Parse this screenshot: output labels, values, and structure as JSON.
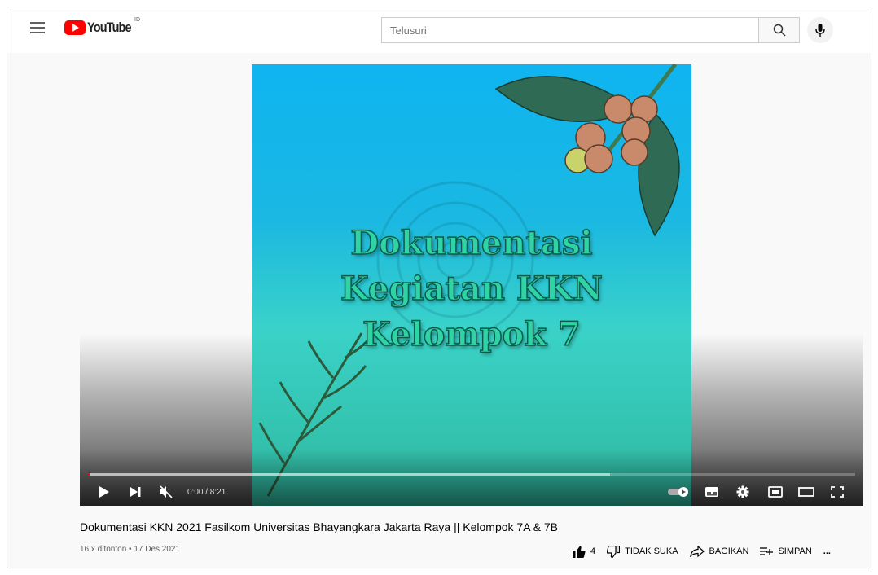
{
  "header": {
    "logo_text": "YouTube",
    "region": "ID",
    "search_placeholder": "Telusuri"
  },
  "player": {
    "video_overlay_lines": [
      "Dokumentasi",
      "Kegiatan KKN",
      "Kelompok 7"
    ],
    "timecode": "0:00 / 8:21",
    "progress_fraction": 0,
    "buffered_fraction": 0.68
  },
  "video": {
    "title": "Dokumentasi KKN 2021 Fasilkom Universitas Bhayangkara Jakarta Raya || Kelompok 7A & 7B",
    "stats": "16 x ditonton • 17 Des 2021",
    "like_count": "4",
    "dislike_label": "TIDAK SUKA",
    "share_label": "BAGIKAN",
    "save_label": "SIMPAN",
    "more_label": "..."
  },
  "colors": {
    "brand": "#ff0000",
    "overlay_text": "#2fd3a6"
  }
}
